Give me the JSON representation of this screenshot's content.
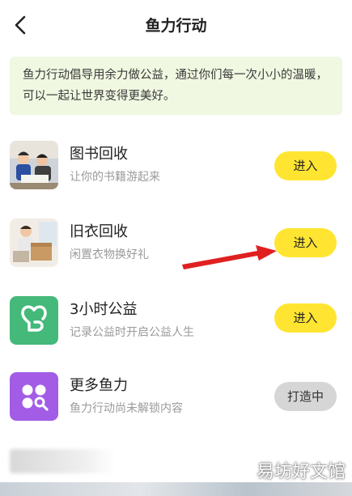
{
  "header": {
    "title": "鱼力行动",
    "back_icon": "chevron-left-icon"
  },
  "notice": {
    "text": "鱼力行动倡导用余力做公益，通过你们每一次小小的温暖， 可以一起让世界变得更美好。"
  },
  "items": [
    {
      "title": "图书回收",
      "subtitle": "让你的书籍游起来",
      "button": "进入",
      "icon": "book-recycle-photo",
      "button_state": "active"
    },
    {
      "title": "旧衣回收",
      "subtitle": "闲置衣物换好礼",
      "button": "进入",
      "icon": "clothes-recycle-photo",
      "button_state": "active"
    },
    {
      "title": "3小时公益",
      "subtitle": "记录公益时开启公益人生",
      "button": "进入",
      "icon": "heart-hands-icon",
      "button_state": "active"
    },
    {
      "title": "更多鱼力",
      "subtitle": "鱼力行动尚未解锁内容",
      "button": "打造中",
      "icon": "grid-search-icon",
      "button_state": "disabled"
    }
  ],
  "watermark": "易坊好文馆",
  "colors": {
    "button_yellow": "#ffe531",
    "button_gray": "#d6d6d6",
    "notice_bg": "#f0f8e1",
    "green_icon": "#44b97a",
    "purple_icon": "#a25ce6",
    "arrow_red": "#e02020"
  }
}
